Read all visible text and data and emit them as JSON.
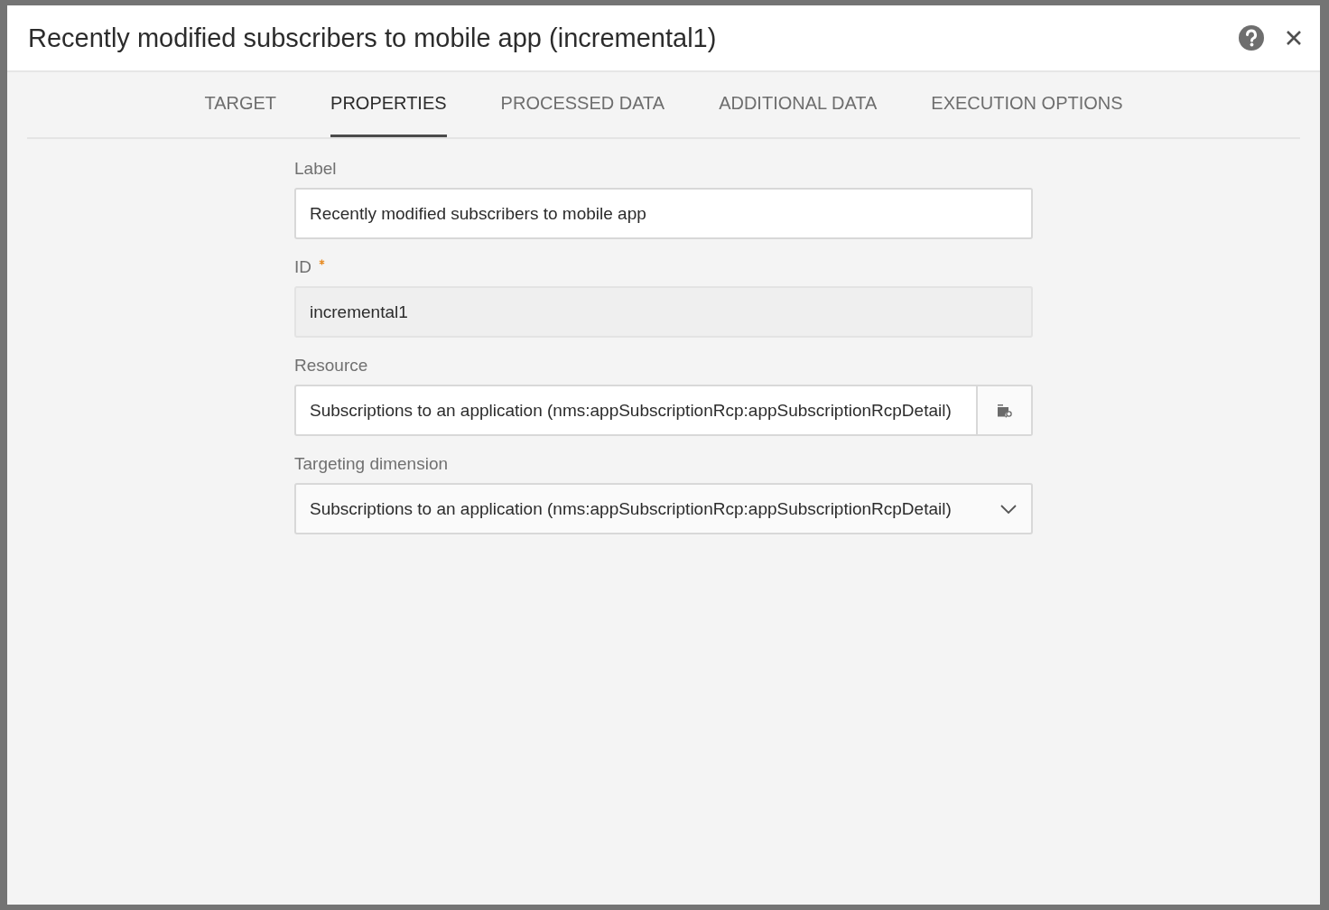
{
  "dialog": {
    "title": "Recently modified subscribers to mobile app (incremental1)"
  },
  "tabs": [
    {
      "label": "TARGET",
      "selected": false
    },
    {
      "label": "PROPERTIES",
      "selected": true
    },
    {
      "label": "PROCESSED DATA",
      "selected": false
    },
    {
      "label": "ADDITIONAL DATA",
      "selected": false
    },
    {
      "label": "EXECUTION OPTIONS",
      "selected": false
    }
  ],
  "fields": [
    {
      "kind": "text",
      "label": "Label",
      "value": "Recently modified subscribers to mobile app",
      "required": false,
      "disabled": false
    },
    {
      "kind": "text",
      "label": "ID",
      "value": "incremental1",
      "required": true,
      "disabled": true
    },
    {
      "kind": "picker",
      "label": "Resource",
      "value": "Subscriptions to an application (nms:appSubscriptionRcp:appSubscriptionRcpDetail)",
      "required": false,
      "disabled": false
    },
    {
      "kind": "select",
      "label": "Targeting dimension",
      "value": "Subscriptions to an application (nms:appSubscriptionRcp:appSubscriptionRcpDetail)",
      "required": false,
      "disabled": false
    }
  ]
}
